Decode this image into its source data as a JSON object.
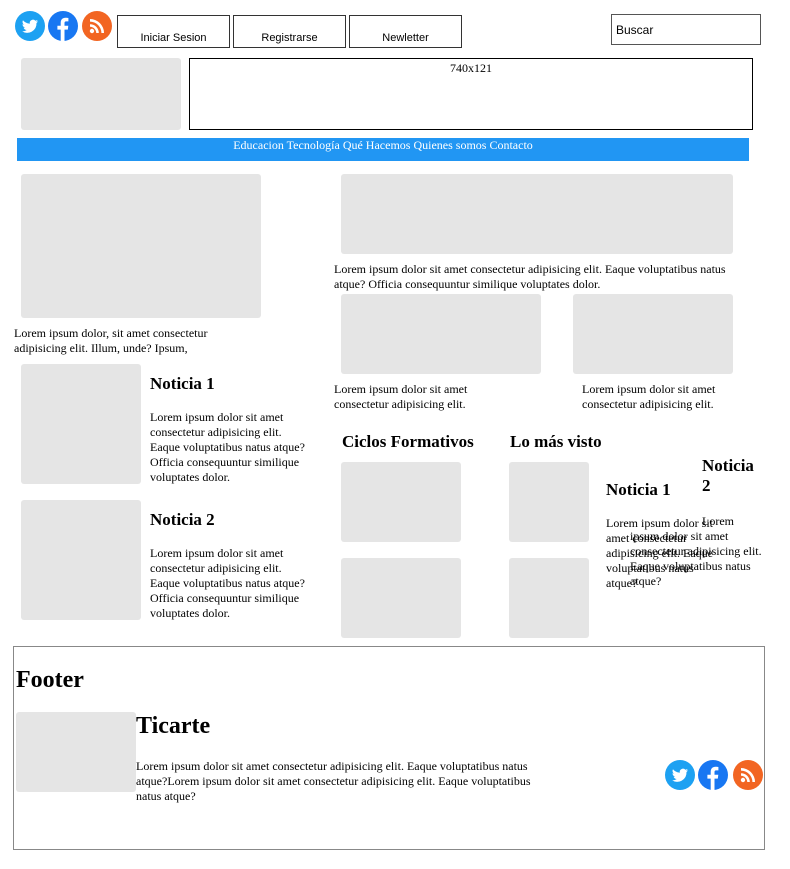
{
  "header": {
    "social_icons": [
      "twitter-icon",
      "facebook-icon",
      "rss-icon"
    ],
    "buttons": [
      "Iniciar Sesion",
      "Registrarse",
      "Newletter"
    ],
    "search": {
      "value": "Buscar"
    }
  },
  "banner": {
    "label": "740x121"
  },
  "nav": {
    "items": [
      "Educacion",
      "Tecnología",
      "Qué Hacemos",
      "Quienes somos",
      "Contacto"
    ]
  },
  "main": {
    "left_feature_text": "Lorem ipsum dolor, sit amet consectetur adipisicing elit. Illum, unde? Ipsum,",
    "left_news": [
      {
        "title": "Noticia 1",
        "text": "Lorem ipsum dolor sit amet consectetur adipisicing elit. Eaque voluptatibus natus atque? Officia consequuntur similique voluptates dolor."
      },
      {
        "title": "Noticia 2",
        "text": "Lorem ipsum dolor sit amet consectetur adipisicing elit. Eaque voluptatibus natus atque? Officia consequuntur similique voluptates dolor."
      }
    ],
    "right_feature_text": "Lorem ipsum dolor sit amet consectetur adipisicing elit. Eaque voluptatibus natus atque? Officia consequuntur similique voluptates dolor.",
    "right_small": [
      {
        "text": "Lorem ipsum dolor sit amet consectetur adipisicing elit."
      },
      {
        "text": "Lorem ipsum dolor sit amet consectetur adipisicing elit."
      }
    ],
    "ciclos_title": "Ciclos Formativos",
    "mas_visto_title": "Lo más visto",
    "mas_visto_news": [
      {
        "title": "Noticia 1",
        "text": "Lorem ipsum dolor sit amet consectetur adipisicing elit. Eaque voluptatibus natus atque?"
      },
      {
        "title": "Noticia 2",
        "text": "Lorem ipsum dolor sit amet consectetur adipisicing elit. Eaque voluptatibus natus atque?"
      }
    ]
  },
  "footer": {
    "heading": "Footer",
    "brand": "Ticarte",
    "text": "Lorem ipsum dolor sit amet consectetur adipisicing elit. Eaque voluptatibus natus atque?Lorem ipsum dolor sit amet consectetur adipisicing elit. Eaque voluptatibus natus atque?",
    "social_icons": [
      "twitter-icon",
      "facebook-icon",
      "rss-icon"
    ]
  },
  "colors": {
    "nav_bg": "#2196f3",
    "twitter": "#1da1f2",
    "facebook": "#1877f2",
    "rss": "#f26522",
    "placeholder": "#e5e5e5"
  }
}
